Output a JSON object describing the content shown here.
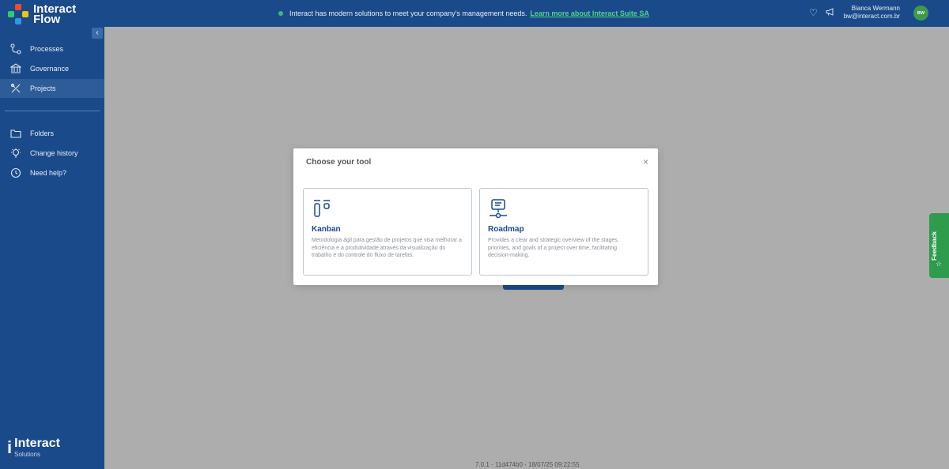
{
  "app": {
    "logo_line1": "Interact",
    "logo_line2": "Flow"
  },
  "sidebar": {
    "items": [
      {
        "label": "Processes",
        "icon": "processes-icon"
      },
      {
        "label": "Governance",
        "icon": "governance-icon"
      },
      {
        "label": "Projects",
        "icon": "projects-icon",
        "active": true
      }
    ],
    "secondary": [
      {
        "label": "Folders",
        "icon": "folder-icon"
      },
      {
        "label": "Change history",
        "icon": "lightbulb-icon"
      },
      {
        "label": "Need help?",
        "icon": "history-icon"
      }
    ],
    "footer_logo": {
      "brand": "Interact",
      "sub": "Solutions",
      "mark": "i"
    }
  },
  "topbar": {
    "announcement": "Interact has modern solutions to meet your company's management needs.",
    "announcement_link": "Learn more about Interact Suite SA",
    "user_name": "Bianca Wermann",
    "user_email": "bw@interact.com.br",
    "avatar_initials": "BW"
  },
  "modal": {
    "title": "Choose your tool",
    "close": "×",
    "cards": [
      {
        "title": "Kanban",
        "description": "Metodologia ágil para gestão de projetos que visa melhorar a eficiência e a produtividade através da visualização do trabalho e do controle do fluxo de tarefas."
      },
      {
        "title": "Roadmap",
        "description": "Provides a clear and strategic overview of the stages, priorities, and goals of a project over time, facilitating decision-making."
      }
    ]
  },
  "footer": {
    "version": "7.0.1 - 11d474b0 - 18/07/25 09:22:55"
  },
  "feedback": {
    "label": "Feedback"
  },
  "colors": {
    "primary": "#1a4a8a",
    "accent": "#3cb878",
    "overlay": "#adadad"
  }
}
